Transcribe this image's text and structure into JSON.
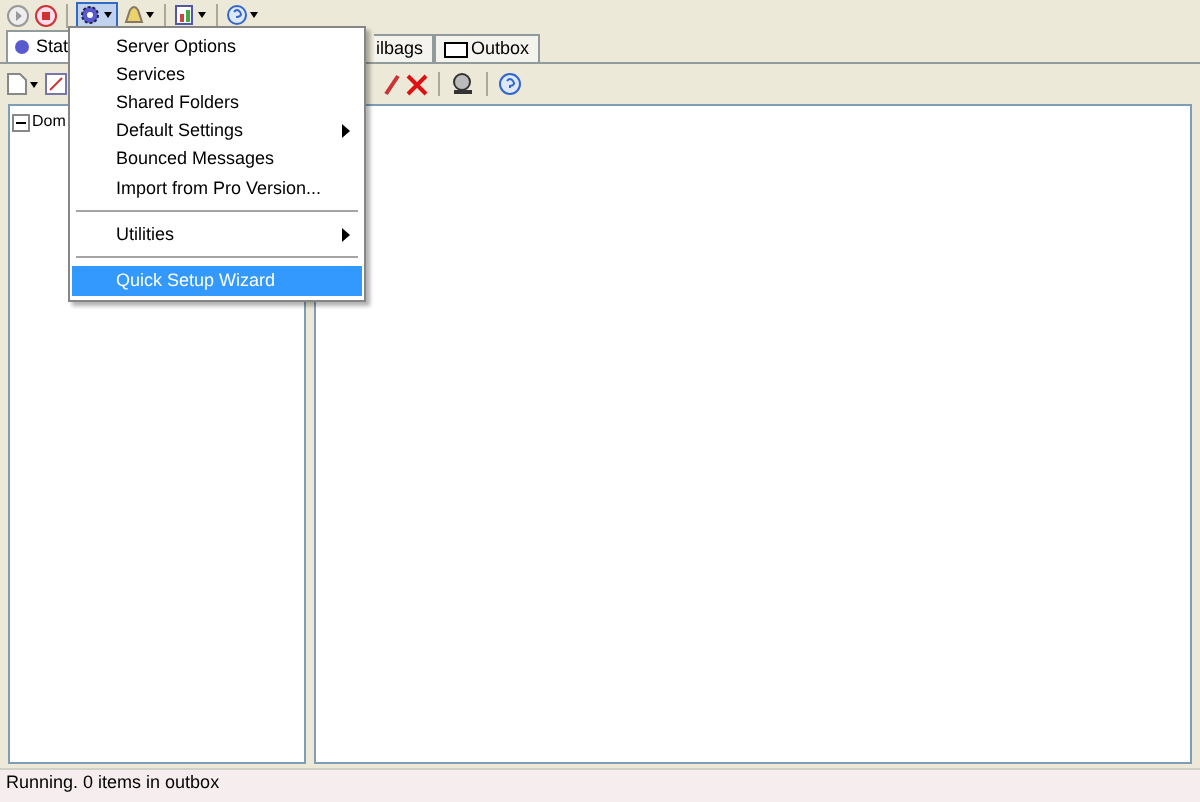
{
  "tabs": [
    {
      "label": "Stat",
      "selected": true
    },
    {
      "label": "ilbags",
      "selected": false
    },
    {
      "label": "Outbox",
      "selected": false
    }
  ],
  "tree": [
    {
      "label": "Dom",
      "expanded": true
    }
  ],
  "menu": {
    "items": [
      {
        "kind": "item",
        "label": "Server Options",
        "submenu": false,
        "selected": false
      },
      {
        "kind": "item",
        "label": "Services",
        "submenu": false,
        "selected": false
      },
      {
        "kind": "item",
        "label": "Shared Folders",
        "submenu": false,
        "selected": false
      },
      {
        "kind": "item",
        "label": "Default Settings",
        "submenu": true,
        "selected": false
      },
      {
        "kind": "item",
        "label": "Bounced Messages",
        "submenu": false,
        "selected": false
      },
      {
        "kind": "item",
        "label": "Import from Pro Version...",
        "submenu": false,
        "selected": false
      },
      {
        "kind": "separator"
      },
      {
        "kind": "item",
        "label": "Utilities",
        "submenu": true,
        "selected": false
      },
      {
        "kind": "separator"
      },
      {
        "kind": "item",
        "label": "Quick Setup Wizard",
        "submenu": false,
        "selected": true
      }
    ]
  },
  "status_bar": "Running.  0 items in outbox"
}
